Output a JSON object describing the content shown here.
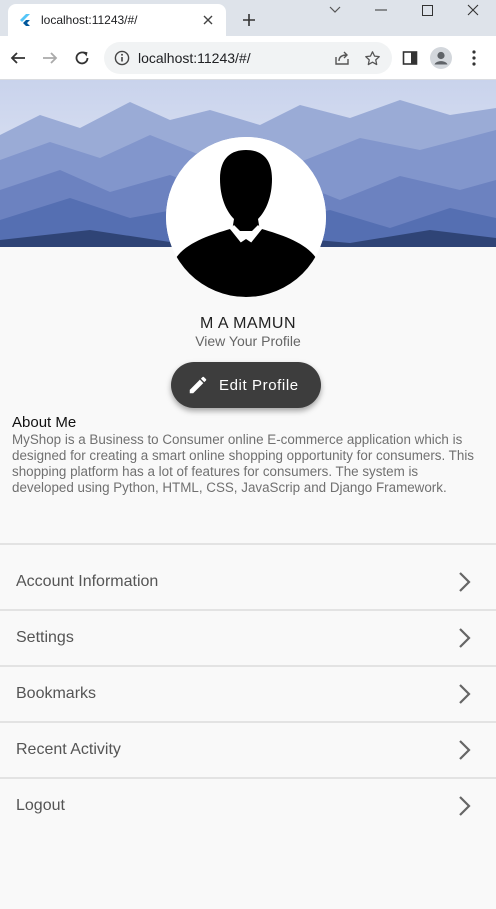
{
  "browser": {
    "tab_title": "localhost:11243/#/",
    "url": "localhost:11243/#/",
    "tab_close_icon": "close-icon",
    "new_tab_icon": "plus-icon"
  },
  "profile": {
    "name": "M A MAMUN",
    "subtitle": "View Your Profile",
    "edit_button_label": "Edit Profile"
  },
  "about": {
    "title": "About Me",
    "body": "MyShop is a Business to Consumer online E-commerce application which is designed for creating a smart online shopping opportunity for consumers. This shopping platform has a lot of features for consumers. The system is developed using Python, HTML, CSS, JavaScrip and Django Framework."
  },
  "menu": {
    "items": [
      {
        "label": "Account Information"
      },
      {
        "label": "Settings"
      },
      {
        "label": "Bookmarks"
      },
      {
        "label": "Recent Activity"
      },
      {
        "label": "Logout"
      }
    ]
  },
  "colors": {
    "button_bg": "#3d3d3d",
    "banner_sky": "#dfe6f6",
    "mountain_dark": "#3f5a9c"
  }
}
